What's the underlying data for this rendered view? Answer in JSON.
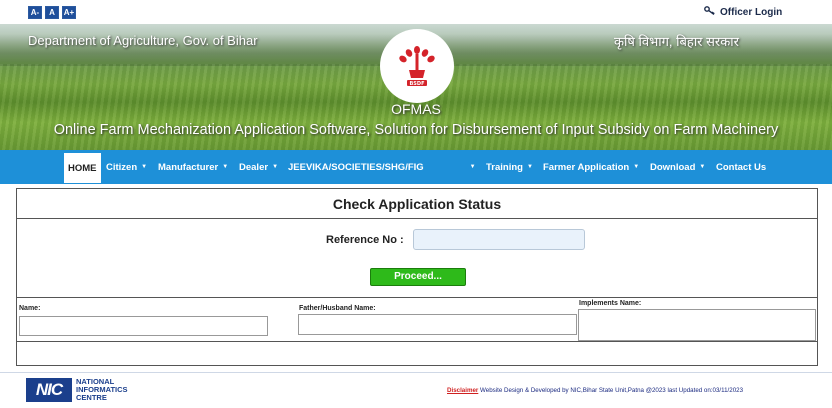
{
  "topbar": {
    "font_buttons": [
      "A-",
      "A",
      "A+"
    ],
    "officer_login": "Officer Login"
  },
  "banner": {
    "dept_english": "Department of Agriculture, Gov. of Bihar",
    "dept_hindi": "कृषि विभाग, बिहार सरकार",
    "logo_text": "BSDF",
    "app_name": "OFMAS",
    "tagline": "Online Farm Mechanization Application Software, Solution for Disbursement of Input Subsidy on Farm Machinery"
  },
  "nav": {
    "items": [
      {
        "label": "HOME",
        "dropdown": false
      },
      {
        "label": "Citizen",
        "dropdown": true
      },
      {
        "label": "Manufacturer",
        "dropdown": true
      },
      {
        "label": "Dealer",
        "dropdown": true
      },
      {
        "label": "JEEVIKA/SOCIETIES/SHG/FIG",
        "dropdown": true
      },
      {
        "label": "Training",
        "dropdown": true
      },
      {
        "label": "Farmer Application",
        "dropdown": true
      },
      {
        "label": "Download",
        "dropdown": true
      },
      {
        "label": "Contact Us",
        "dropdown": false
      }
    ],
    "caret": "▼"
  },
  "form": {
    "title": "Check Application Status",
    "reference_label": "Reference No :",
    "reference_value": "",
    "proceed_label": "Proceed...",
    "fields": [
      {
        "label": "Name:",
        "value": ""
      },
      {
        "label": "Father/Husband Name:",
        "value": ""
      },
      {
        "label": "Implements Name:",
        "value": ""
      }
    ]
  },
  "footer": {
    "nic_mark": "NIC",
    "nic_name_lines": [
      "NATIONAL",
      "INFORMATICS",
      "CENTRE"
    ],
    "disclaimer": "Disclaimer",
    "credits": " Website Design & Developed by NIC,Bihar State Unit,Patna @2023 last Updated on:03/11/2023"
  },
  "colors": {
    "nav_bg": "#1e90d8",
    "proceed_bg": "#2eba1a",
    "input_bg": "#e9f2fb"
  }
}
